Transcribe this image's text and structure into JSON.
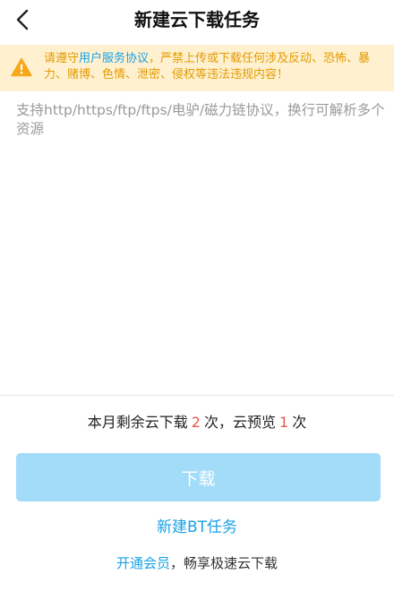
{
  "header": {
    "title": "新建云下载任务",
    "back_icon": "chevron-left-icon"
  },
  "notice": {
    "icon": "warning-icon",
    "text_before_link": "请遵守",
    "link_text": "用户服务协议",
    "text_after_link": "，严禁上传或下载任何涉及反动、恐怖、暴力、赌博、色情、泄密、侵权等违法违规内容！"
  },
  "input": {
    "placeholder": "支持http/https/ftp/ftps/电驴/磁力链协议，换行可解析多个资源",
    "value": ""
  },
  "quota": {
    "prefix": "本月剩余云下载",
    "download_count": "2",
    "middle": "次，云预览",
    "preview_count": "1",
    "suffix": "次"
  },
  "download_button": {
    "label": "下载"
  },
  "new_bt_task": {
    "label": "新建BT任务"
  },
  "promo": {
    "link_text": "开通会员",
    "text": "，畅享极速云下载"
  },
  "colors": {
    "accent": "#1aa1e6",
    "warning_text": "#e39a00",
    "warning_bg": "#fff1cf",
    "count_red": "#e8564e",
    "button_disabled": "#a3dcf9"
  }
}
